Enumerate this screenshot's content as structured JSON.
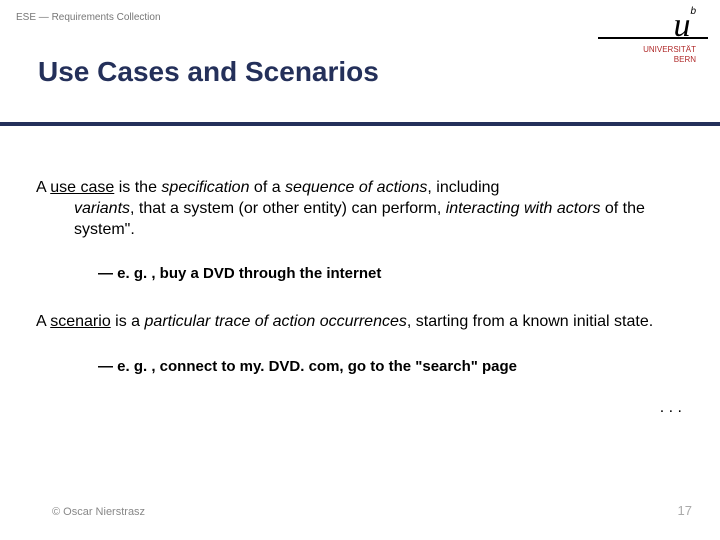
{
  "header": {
    "label": "ESE — Requirements Collection"
  },
  "logo": {
    "small": "b",
    "big": "u",
    "line1": "UNIVERSITÄT",
    "line2": "BERN"
  },
  "title": "Use Cases and Scenarios",
  "body": {
    "p1_a": "A ",
    "p1_b": "use case",
    "p1_c": " is the ",
    "p1_d": "specification",
    "p1_e": " of a ",
    "p1_f": "sequence of actions",
    "p1_g": ", including ",
    "p1_h": "variants",
    "p1_i": ", that a system (or other entity) can perform, ",
    "p1_j": "interacting with actors",
    "p1_k": " of the system\".",
    "ex1": "— e. g. , buy a DVD through the internet",
    "p2_a": "A ",
    "p2_b": "scenario",
    "p2_c": " is a ",
    "p2_d": "particular trace of action occurrences",
    "p2_e": ", starting from a known initial state.",
    "ex2": "— e. g. , connect to my. DVD. com, go to the \"search\" page",
    "ellipsis": ". . ."
  },
  "footer": {
    "left": "© Oscar Nierstrasz",
    "right": "17"
  }
}
